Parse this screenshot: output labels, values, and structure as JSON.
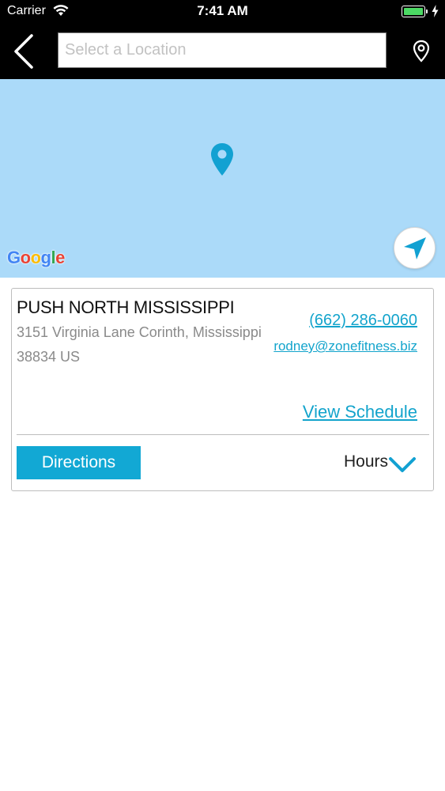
{
  "status_bar": {
    "carrier": "Carrier",
    "time": "7:41 AM"
  },
  "nav": {
    "search_placeholder": "Select a Location",
    "search_value": ""
  },
  "map": {
    "attribution": "Google",
    "marker_color": "#12a1d2",
    "water_color": "#abdaf9"
  },
  "location": {
    "name": "PUSH NORTH MISSISSIPPI",
    "address_line1": "3151 Virginia Lane Corinth, Mississippi",
    "address_line2": "38834 US",
    "phone": "(662) 286-0060",
    "email": "rodney@zonefitness.biz",
    "schedule_link": "View Schedule",
    "directions_label": "Directions",
    "hours_label": "Hours"
  },
  "colors": {
    "accent": "#12a8d4",
    "link": "#13a4cc",
    "header_bg": "#000000"
  }
}
